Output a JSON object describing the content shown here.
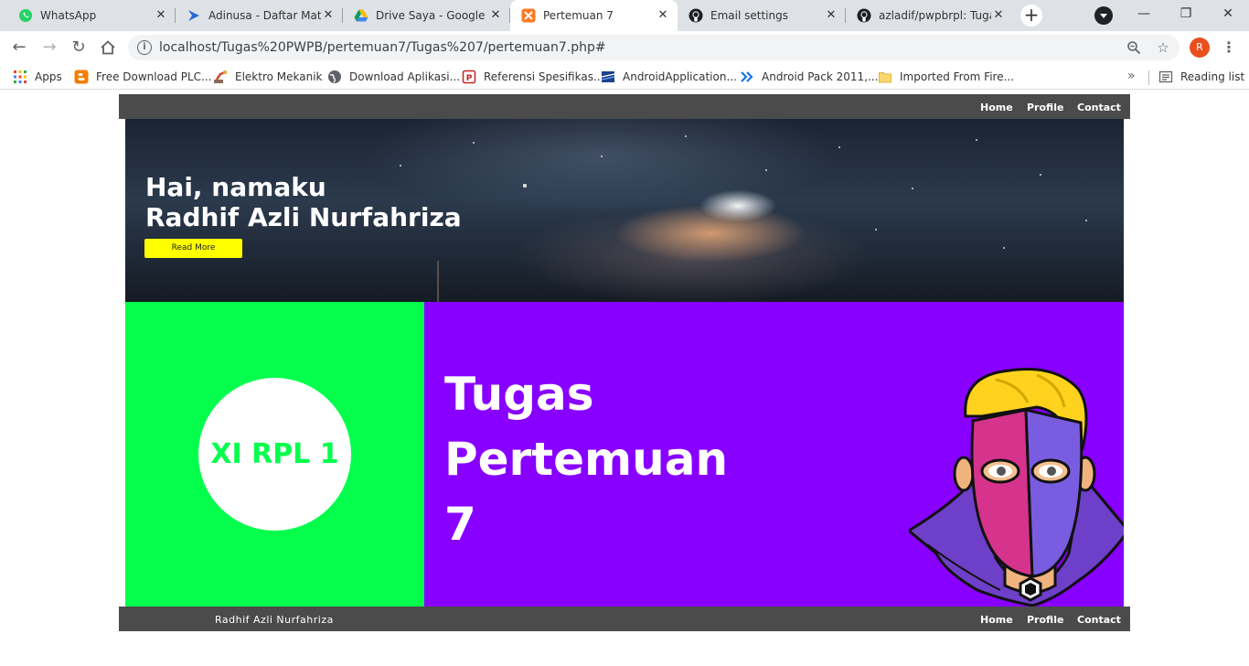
{
  "browser": {
    "tabs": [
      {
        "title": "WhatsApp",
        "icon": "whatsapp-icon"
      },
      {
        "title": "Adinusa - Daftar Mate",
        "icon": "adinusa-icon"
      },
      {
        "title": "Drive Saya - Google D",
        "icon": "google-drive-icon"
      },
      {
        "title": "Pertemuan 7",
        "icon": "xampp-icon",
        "active": true
      },
      {
        "title": "Email settings",
        "icon": "github-icon"
      },
      {
        "title": "azladif/pwpbrpl: Tugas",
        "icon": "github-icon"
      }
    ],
    "address": "localhost/Tugas%20PWPB/pertemuan7/Tugas%207/pertemuan7.php#",
    "profile_initial": "R",
    "bookmarks": [
      {
        "label": "Apps",
        "icon": "apps-grid-icon"
      },
      {
        "label": "Free Download PLC...",
        "icon": "blogger-icon"
      },
      {
        "label": "Elektro Mekanik",
        "icon": "robot-arm-icon"
      },
      {
        "label": "Download Aplikasi...",
        "icon": "globe-icon"
      },
      {
        "label": "Referensi Spesifikas...",
        "icon": "pdf-icon"
      },
      {
        "label": "AndroidApplication...",
        "icon": "book-icon"
      },
      {
        "label": "Android Pack 2011,...",
        "icon": "chevrons-icon"
      },
      {
        "label": "Imported From Fire...",
        "icon": "folder-icon"
      }
    ],
    "reading_list": "Reading list",
    "more_glyph": "»"
  },
  "site": {
    "nav": {
      "home": "Home",
      "profile": "Profile",
      "contact": "Contact"
    },
    "hero": {
      "line1": "Hai, namaku",
      "line2": "Radhif Azli Nurfahriza",
      "button": "Read More"
    },
    "class_badge": "XI RPL 1",
    "title_lines": [
      "Tugas",
      "Pertemuan",
      "7"
    ],
    "footer": {
      "name": "Radhif Azli Nurfahriza",
      "home": "Home",
      "profile": "Profile",
      "contact": "Contact"
    }
  },
  "colors": {
    "nav_bg": "#4b4b4b",
    "left_panel": "#03ff4c",
    "right_panel": "#8800ff",
    "button": "#ffff00"
  }
}
